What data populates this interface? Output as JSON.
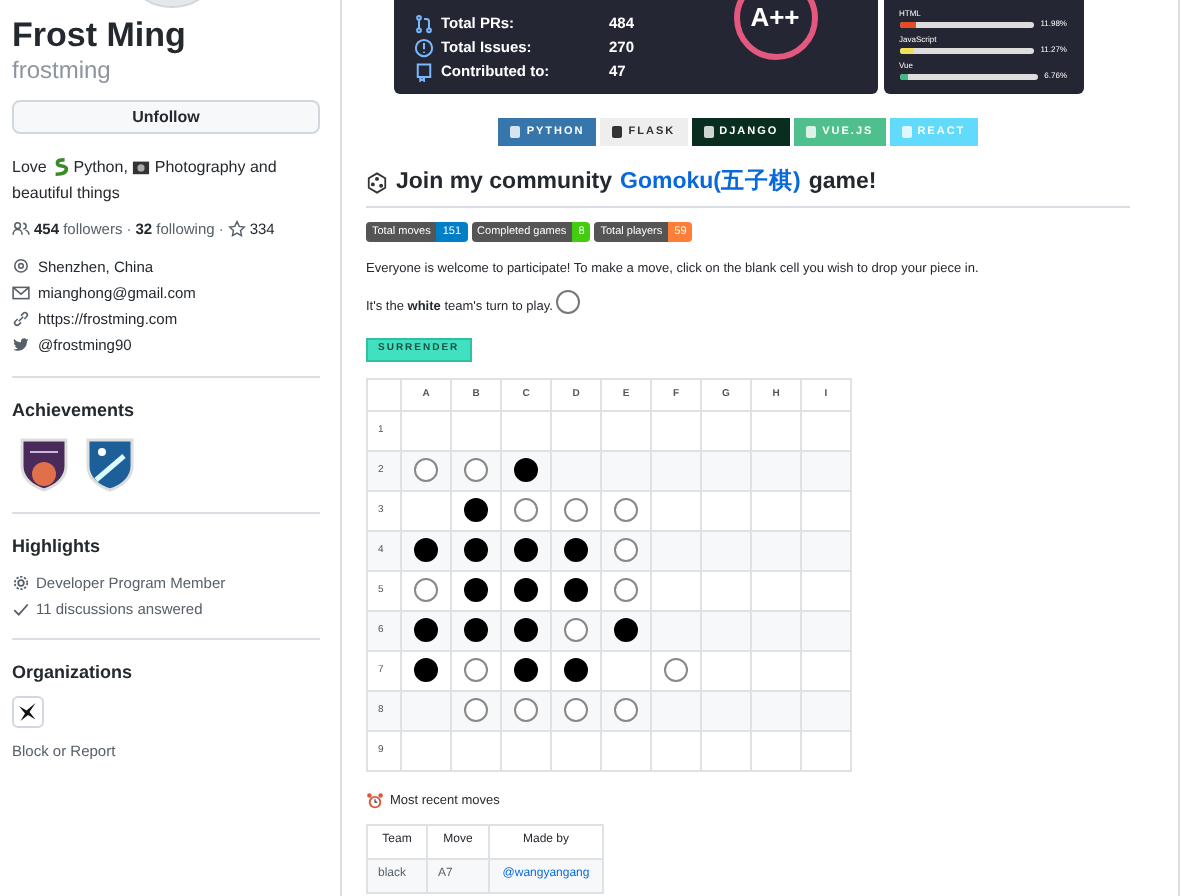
{
  "profile": {
    "name": "Frost Ming",
    "login": "frostming",
    "follow_button": "Unfollow",
    "bio": [
      {
        "kind": "text",
        "text": "Love "
      },
      {
        "kind": "snake",
        "text": " Python, "
      },
      {
        "kind": "camera",
        "text": " Photography and beautiful things"
      }
    ],
    "followers": "454",
    "followers_label": "followers",
    "following": "32",
    "following_label": "following",
    "stars": "334",
    "separators": [
      "·",
      "·"
    ],
    "details": [
      {
        "kind": "location",
        "text": "Shenzhen, China"
      },
      {
        "kind": "email",
        "text": "mianghong@gmail.com"
      },
      {
        "kind": "link",
        "text": "https://frostming.com"
      },
      {
        "kind": "twitter",
        "text": "@frostming90"
      }
    ]
  },
  "achievements": {
    "title": "Achievements"
  },
  "highlights": {
    "title": "Highlights",
    "items": [
      {
        "kind": "gear",
        "text": "Developer Program Member"
      },
      {
        "kind": "check",
        "text": "11 discussions answered"
      }
    ]
  },
  "organizations": {
    "title": "Organizations"
  },
  "block_link": "Block or Report",
  "stats": {
    "rows": [
      {
        "kind": "pr",
        "label": "Total PRs:",
        "value": "484"
      },
      {
        "kind": "issue",
        "label": "Total Issues:",
        "value": "270"
      },
      {
        "kind": "repo",
        "label": "Contributed to:",
        "value": "47"
      }
    ],
    "rank": "A++"
  },
  "languages": [
    {
      "name": "HTML",
      "percent": "11.98%",
      "level": 0.12,
      "color": "#e34c26"
    },
    {
      "name": "JavaScript",
      "percent": "11.27%",
      "level": 0.11,
      "color": "#f1e05a"
    },
    {
      "name": "Vue",
      "percent": "6.76%",
      "level": 0.07,
      "color": "#41b883"
    }
  ],
  "tech_badges": [
    {
      "label": "PYTHON",
      "color": "#3776ab"
    },
    {
      "label": "FLASK",
      "color": "#eeeeee"
    },
    {
      "label": "DJANGO",
      "color": "#092e20"
    },
    {
      "label": "VUE.JS",
      "color": "#4fc08d"
    },
    {
      "label": "REACT",
      "color": "#61dafb"
    }
  ],
  "game": {
    "title_before": "Join my community ",
    "title_link": "Gomoku(五子棋)",
    "title_after": " game!",
    "counters": [
      {
        "label": "Total moves",
        "value": "151",
        "color": "#007ec6"
      },
      {
        "label": "Completed games",
        "value": "8",
        "color": "#4c1"
      },
      {
        "label": "Total players",
        "value": "59",
        "color": "#fe7d37"
      }
    ],
    "intro": "Everyone is welcome to participate! To make a move, click on the blank cell you wish to drop your piece in.",
    "turn": "It's the **white** team's turn to play.",
    "turn_stone": {
      "kind": "white"
    },
    "surrender": "SURRENDER",
    "columns": [
      "A",
      "B",
      "C",
      "D",
      "E",
      "F",
      "G",
      "H",
      "I"
    ],
    "rows": [
      {
        "label": "1",
        "cells": [
          {
            "kind": "empty"
          },
          {
            "kind": "empty"
          },
          {
            "kind": "empty"
          },
          {
            "kind": "empty"
          },
          {
            "kind": "empty"
          },
          {
            "kind": "empty"
          },
          {
            "kind": "empty"
          },
          {
            "kind": "empty"
          },
          {
            "kind": "empty"
          }
        ]
      },
      {
        "label": "2",
        "cells": [
          {
            "kind": "white"
          },
          {
            "kind": "white"
          },
          {
            "kind": "black"
          },
          {
            "kind": "empty"
          },
          {
            "kind": "empty"
          },
          {
            "kind": "empty"
          },
          {
            "kind": "empty"
          },
          {
            "kind": "empty"
          },
          {
            "kind": "empty"
          }
        ]
      },
      {
        "label": "3",
        "cells": [
          {
            "kind": "empty"
          },
          {
            "kind": "black"
          },
          {
            "kind": "white"
          },
          {
            "kind": "white"
          },
          {
            "kind": "white"
          },
          {
            "kind": "empty"
          },
          {
            "kind": "empty"
          },
          {
            "kind": "empty"
          },
          {
            "kind": "empty"
          }
        ]
      },
      {
        "label": "4",
        "cells": [
          {
            "kind": "black"
          },
          {
            "kind": "black"
          },
          {
            "kind": "black"
          },
          {
            "kind": "black"
          },
          {
            "kind": "white"
          },
          {
            "kind": "empty"
          },
          {
            "kind": "empty"
          },
          {
            "kind": "empty"
          },
          {
            "kind": "empty"
          }
        ]
      },
      {
        "label": "5",
        "cells": [
          {
            "kind": "white"
          },
          {
            "kind": "black"
          },
          {
            "kind": "black"
          },
          {
            "kind": "black"
          },
          {
            "kind": "white"
          },
          {
            "kind": "empty"
          },
          {
            "kind": "empty"
          },
          {
            "kind": "empty"
          },
          {
            "kind": "empty"
          }
        ]
      },
      {
        "label": "6",
        "cells": [
          {
            "kind": "black"
          },
          {
            "kind": "black"
          },
          {
            "kind": "black"
          },
          {
            "kind": "white"
          },
          {
            "kind": "black"
          },
          {
            "kind": "empty"
          },
          {
            "kind": "empty"
          },
          {
            "kind": "empty"
          },
          {
            "kind": "empty"
          }
        ]
      },
      {
        "label": "7",
        "cells": [
          {
            "kind": "black"
          },
          {
            "kind": "white"
          },
          {
            "kind": "black"
          },
          {
            "kind": "black"
          },
          {
            "kind": "empty"
          },
          {
            "kind": "white"
          },
          {
            "kind": "empty"
          },
          {
            "kind": "empty"
          },
          {
            "kind": "empty"
          }
        ]
      },
      {
        "label": "8",
        "cells": [
          {
            "kind": "empty"
          },
          {
            "kind": "white"
          },
          {
            "kind": "white"
          },
          {
            "kind": "white"
          },
          {
            "kind": "white"
          },
          {
            "kind": "empty"
          },
          {
            "kind": "empty"
          },
          {
            "kind": "empty"
          },
          {
            "kind": "empty"
          }
        ]
      },
      {
        "label": "9",
        "cells": [
          {
            "kind": "empty"
          },
          {
            "kind": "empty"
          },
          {
            "kind": "empty"
          },
          {
            "kind": "empty"
          },
          {
            "kind": "empty"
          },
          {
            "kind": "empty"
          },
          {
            "kind": "empty"
          },
          {
            "kind": "empty"
          },
          {
            "kind": "empty"
          }
        ]
      }
    ],
    "recent_title": "Most recent moves",
    "recent_columns": [
      "Team",
      "Move",
      "Made by"
    ],
    "recent_rows": [
      [
        "black",
        "A7",
        "@wangyangang"
      ]
    ]
  }
}
